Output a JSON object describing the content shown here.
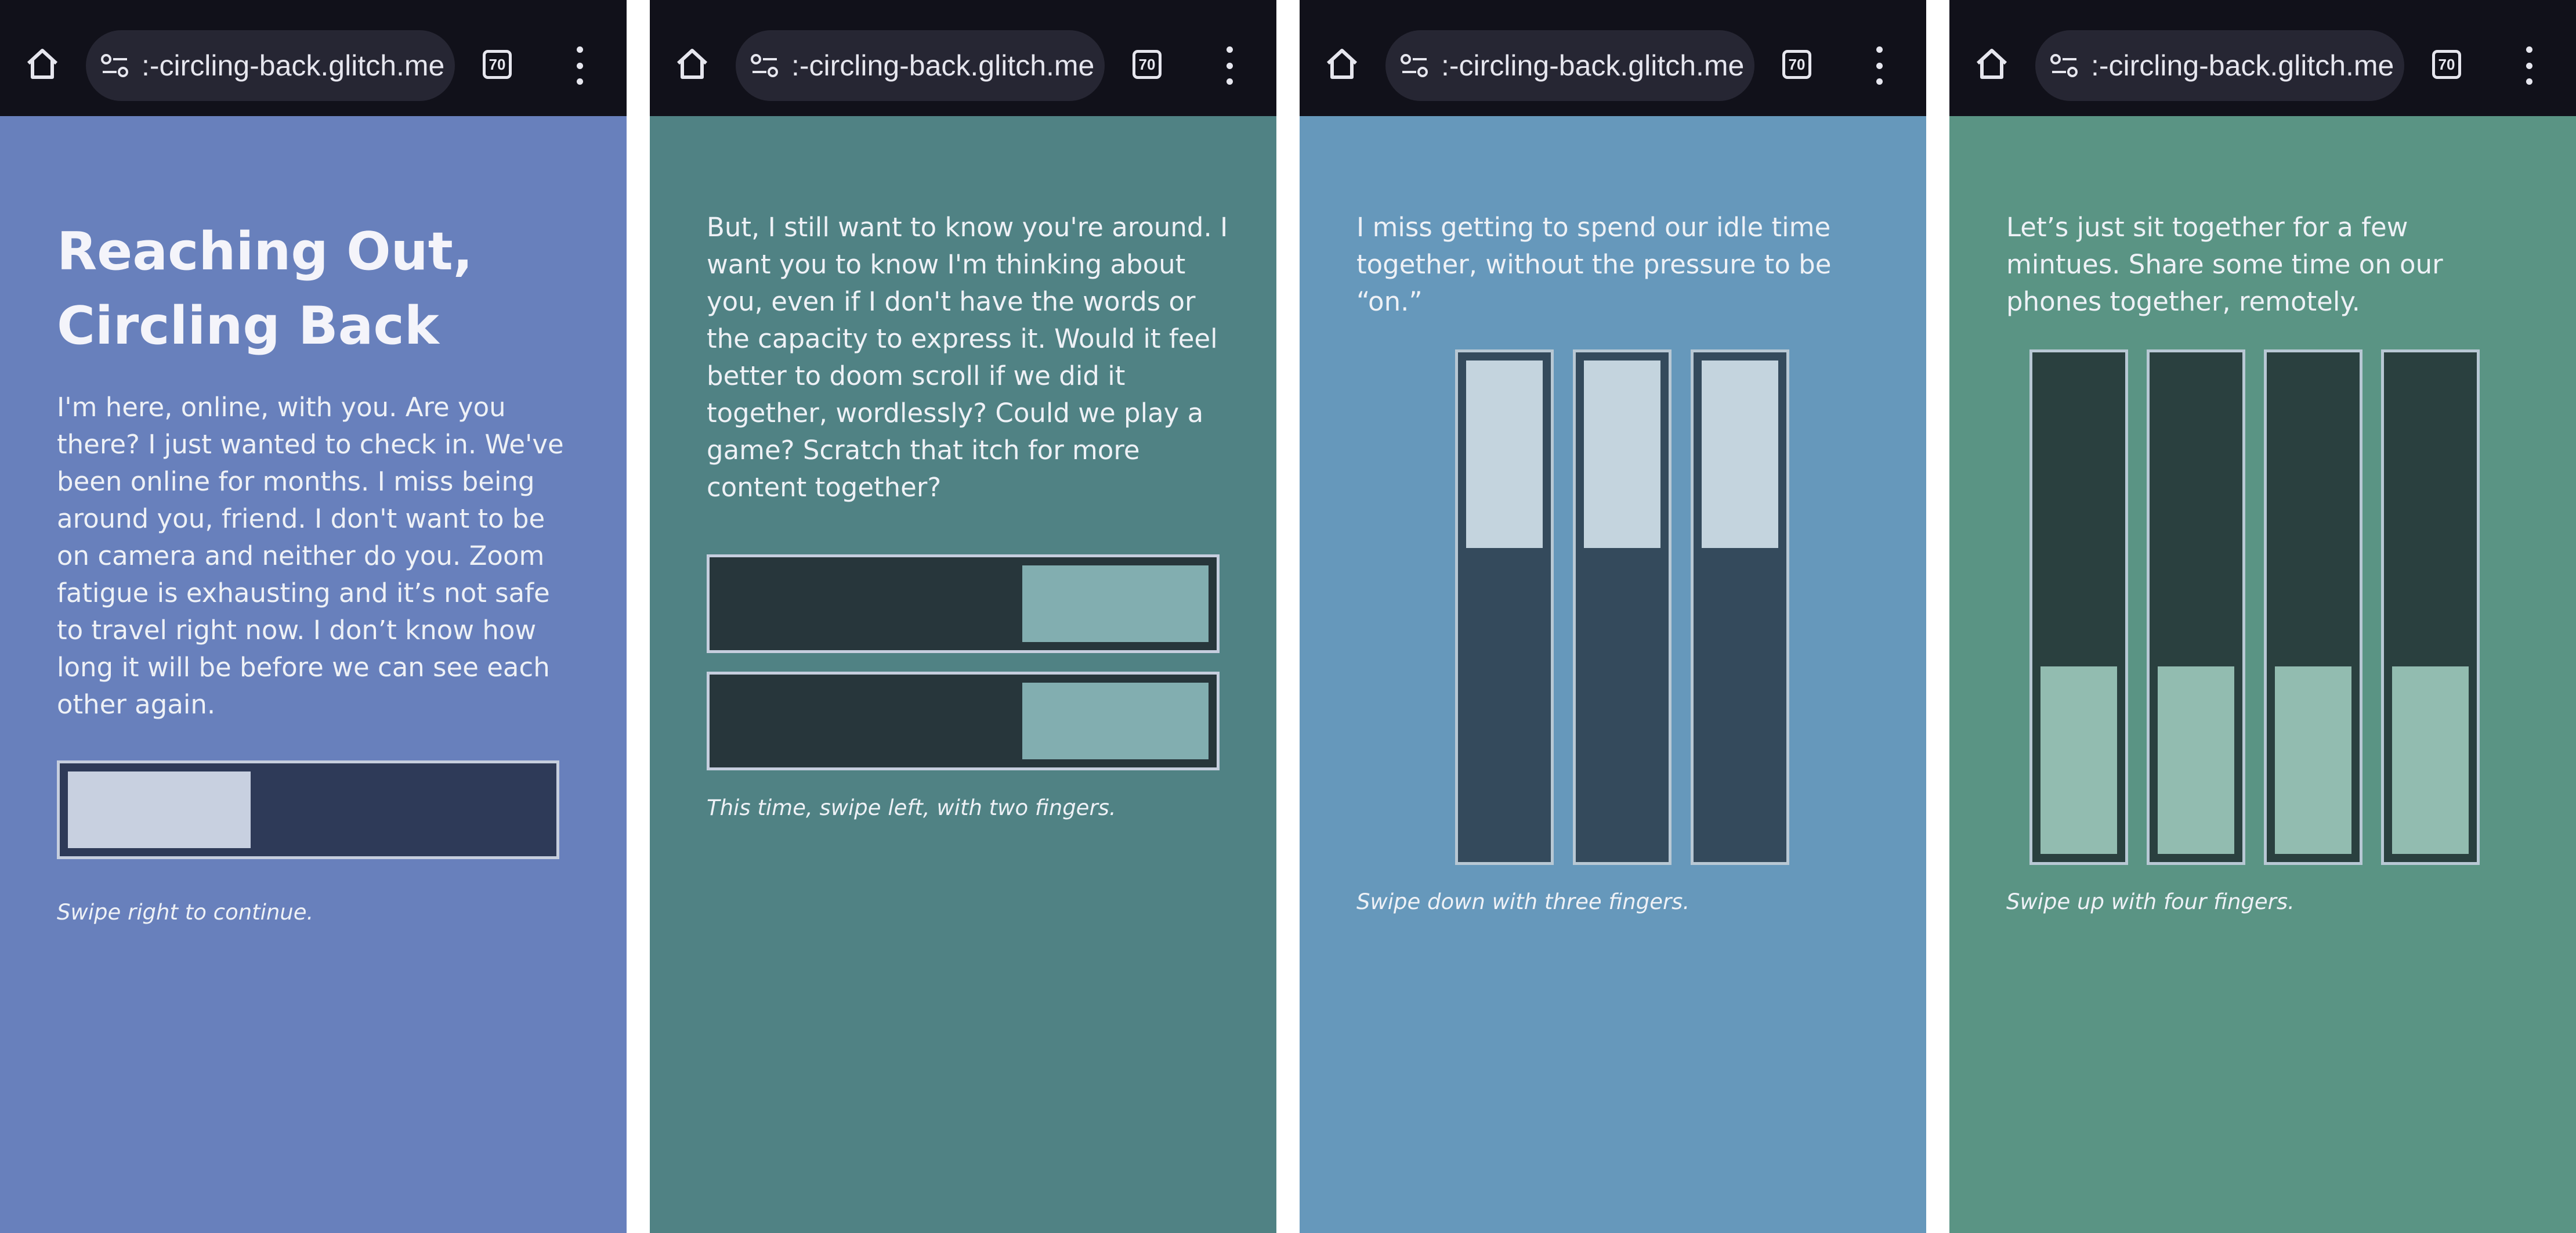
{
  "browser": {
    "url": ":-circling-back.glitch.me",
    "tab_count": "70",
    "icons": [
      "home-icon",
      "site-settings-icon",
      "tab-switcher-icon",
      "more-vertical-icon"
    ]
  },
  "screens": [
    {
      "background": "#6880bc",
      "title_line1": "Reaching Out,",
      "title_line2": "Circling Back",
      "body": "I'm here, online, with you. Are you there? I just wanted to check in. We've been online for months. I miss being around you, friend. I don't want to be on camera and neither do you. Zoom fatigue is exhausting and it’s not safe to travel right now. I don’t know how long it will be before we can see each other again.",
      "hint": "Swipe right to continue.",
      "slider": {
        "value": 0.38,
        "track_color": "#2e3a58",
        "thumb_color": "#c8d0e0"
      }
    },
    {
      "background": "#508284",
      "body": "But, I still want to know you're around. I want you to know I'm thinking about you, even if I don't have the words or the capacity to express it. Would it feel better to doom scroll if we did it together, wordlessly? Could we play a game? Scratch that itch for more content together?",
      "hint": "This time, swipe left, with two fingers.",
      "sliders": [
        0.38,
        0.38
      ],
      "track_color": "#27363b",
      "thumb_color": "#82aeb0"
    },
    {
      "background": "#6698bb",
      "body": "I miss getting to spend our idle time together, without the pressure to be “on.”",
      "hint": "Swipe down with three fingers.",
      "sliders": [
        0.38,
        0.38,
        0.38
      ],
      "track_color": "#344a5c",
      "thumb_color": "#c4d4de"
    },
    {
      "background": "#5a9484",
      "body": "Let’s just sit together for a few mintues. Share some time on our phones together, remotely.",
      "hint": "Swipe up with four fingers.",
      "sliders": [
        0.38,
        0.38,
        0.38,
        0.38
      ],
      "track_color": "#2a403f",
      "thumb_color": "#92bcb0"
    }
  ]
}
